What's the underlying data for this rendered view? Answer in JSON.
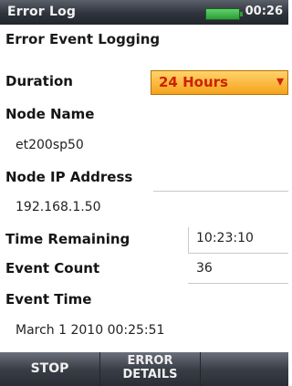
{
  "titlebar": {
    "title": "Error Log",
    "time": "00:26"
  },
  "heading": "Error Event Logging",
  "duration": {
    "label": "Duration",
    "selected": "24 Hours",
    "arrow": "▾"
  },
  "node_name": {
    "label": "Node Name",
    "value": "et200sp50"
  },
  "node_ip": {
    "label": "Node IP Address",
    "value": "192.168.1.50"
  },
  "time_remaining": {
    "label": "Time Remaining",
    "value": "10:23:10"
  },
  "event_count": {
    "label": "Event Count",
    "value": "36"
  },
  "event_time": {
    "label": "Event Time",
    "value": "March 1 2010 00:25:51"
  },
  "softkeys": {
    "stop": "STOP",
    "error_details_line1": "ERROR",
    "error_details_line2": "DETAILS",
    "empty": ""
  },
  "colors": {
    "accent": "#f5a21c",
    "selected_text": "#cc2200",
    "battery": "#2e9b39"
  }
}
